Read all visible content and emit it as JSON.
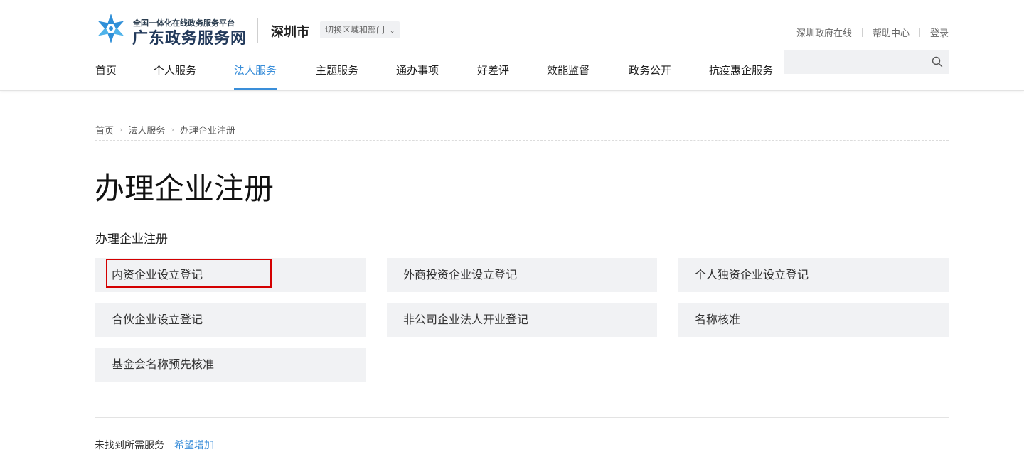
{
  "header": {
    "logo_subtitle": "全国一体化在线政务服务平台",
    "logo_title": "广东政务服务网",
    "city": "深圳市",
    "switch_label": "切换区域和部门",
    "top_links": [
      "深圳政府在线",
      "帮助中心",
      "登录"
    ],
    "nav": [
      {
        "label": "首页",
        "active": false
      },
      {
        "label": "个人服务",
        "active": false
      },
      {
        "label": "法人服务",
        "active": true
      },
      {
        "label": "主题服务",
        "active": false
      },
      {
        "label": "通办事项",
        "active": false
      },
      {
        "label": "好差评",
        "active": false
      },
      {
        "label": "效能监督",
        "active": false
      },
      {
        "label": "政务公开",
        "active": false
      },
      {
        "label": "抗疫惠企服务",
        "active": false
      }
    ],
    "search": {
      "placeholder": "",
      "icon": "search-icon"
    }
  },
  "breadcrumb": [
    "首页",
    "法人服务",
    "办理企业注册"
  ],
  "page_title": "办理企业注册",
  "section_title": "办理企业注册",
  "cards": [
    "内资企业设立登记",
    "外商投资企业设立登记",
    "个人独资企业设立登记",
    "合伙企业设立登记",
    "非公司企业法人开业登记",
    "名称核准",
    "基金会名称预先核准"
  ],
  "footer_hint": {
    "text": "未找到所需服务",
    "link": "希望增加"
  },
  "colors": {
    "accent": "#3a8ed9",
    "highlight_border": "#d40000",
    "card_bg": "#f1f2f4"
  }
}
